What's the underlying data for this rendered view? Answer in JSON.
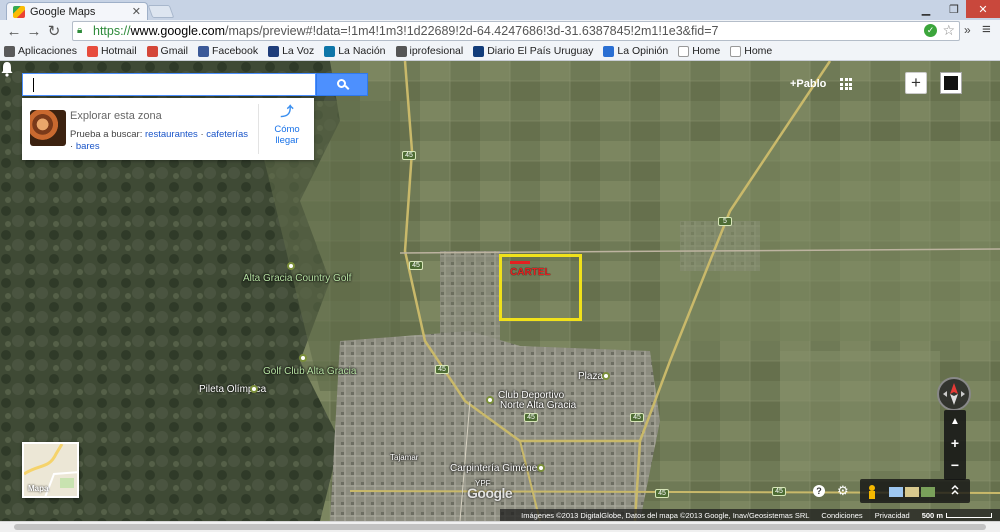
{
  "browser": {
    "tab_title": "Google Maps",
    "url_scheme": "https://",
    "url_host": "www.google.com",
    "url_path": "/maps/preview#!data=!1m4!1m3!1d22689!2d-64.4247686!3d-31.6387845!2m1!1e3&fid=7",
    "bookmarks": [
      {
        "label": "Aplicaciones",
        "icon": "apps-grid-icon",
        "color": "#5a5a5a"
      },
      {
        "label": "Hotmail",
        "icon": "windows-flag-icon",
        "color": "#e74c3c"
      },
      {
        "label": "Gmail",
        "icon": "gmail-icon",
        "color": "#d44638"
      },
      {
        "label": "Facebook",
        "icon": "facebook-icon",
        "color": "#3b5998"
      },
      {
        "label": "La Voz",
        "icon": "la-voz-icon",
        "color": "#1f3d7a"
      },
      {
        "label": "La Nación",
        "icon": "linkedin-style-icon",
        "color": "#0e76a8"
      },
      {
        "label": "iprofesional",
        "icon": "iprofesional-icon",
        "color": "#555555"
      },
      {
        "label": "Diario El País Uruguay",
        "icon": "el-pais-icon",
        "color": "#123c7a"
      },
      {
        "label": "La Opinión",
        "icon": "la-opinion-icon",
        "color": "#2a6fd3"
      },
      {
        "label": "Home",
        "icon": "page-icon",
        "color": "#ffffff"
      },
      {
        "label": "Home",
        "icon": "page-icon",
        "color": "#ffffff"
      }
    ]
  },
  "maps": {
    "search_placeholder": "",
    "explore_title": "Explorar esta zona",
    "explore_try": "Prueba a buscar:",
    "explore_links": [
      "restaurantes",
      "cafeterías",
      "bares"
    ],
    "directions_label": "Cómo llegar",
    "user_name": "+Pablo",
    "map_type_label": "Mapa",
    "google_logo": "Google",
    "footer": {
      "attribution": "Imágenes ©2013 DigitalGlobe, Datos del mapa ©2013 Google, Inav/Geosistemas SRL",
      "terms": "Condiciones",
      "privacy": "Privacidad",
      "scale": "500 m"
    },
    "zoom_in": "+",
    "zoom_out": "−",
    "labels": {
      "country_golf": "Alta Gracia Country Golf",
      "golf_club": "Golf Club Alta Gracia",
      "pileta": "Pileta Olímpica",
      "club_line1": "Club Deportivo",
      "club_line2": "Norte Alta Gracia",
      "plaza": "Plaza",
      "carpinteria": "Carpintería Giménez",
      "tajamar": "Tajamar",
      "ypf": "YPF",
      "cartel": "CARTEL"
    },
    "route_shields": [
      "45",
      "45",
      "45",
      "45",
      "45",
      "45",
      "45",
      "5"
    ],
    "colors": {
      "accent": "#4d90fe",
      "highlight_box": "#f0e11a",
      "marker_red": "#e52020",
      "poi_green": "#b8e3a4"
    }
  }
}
